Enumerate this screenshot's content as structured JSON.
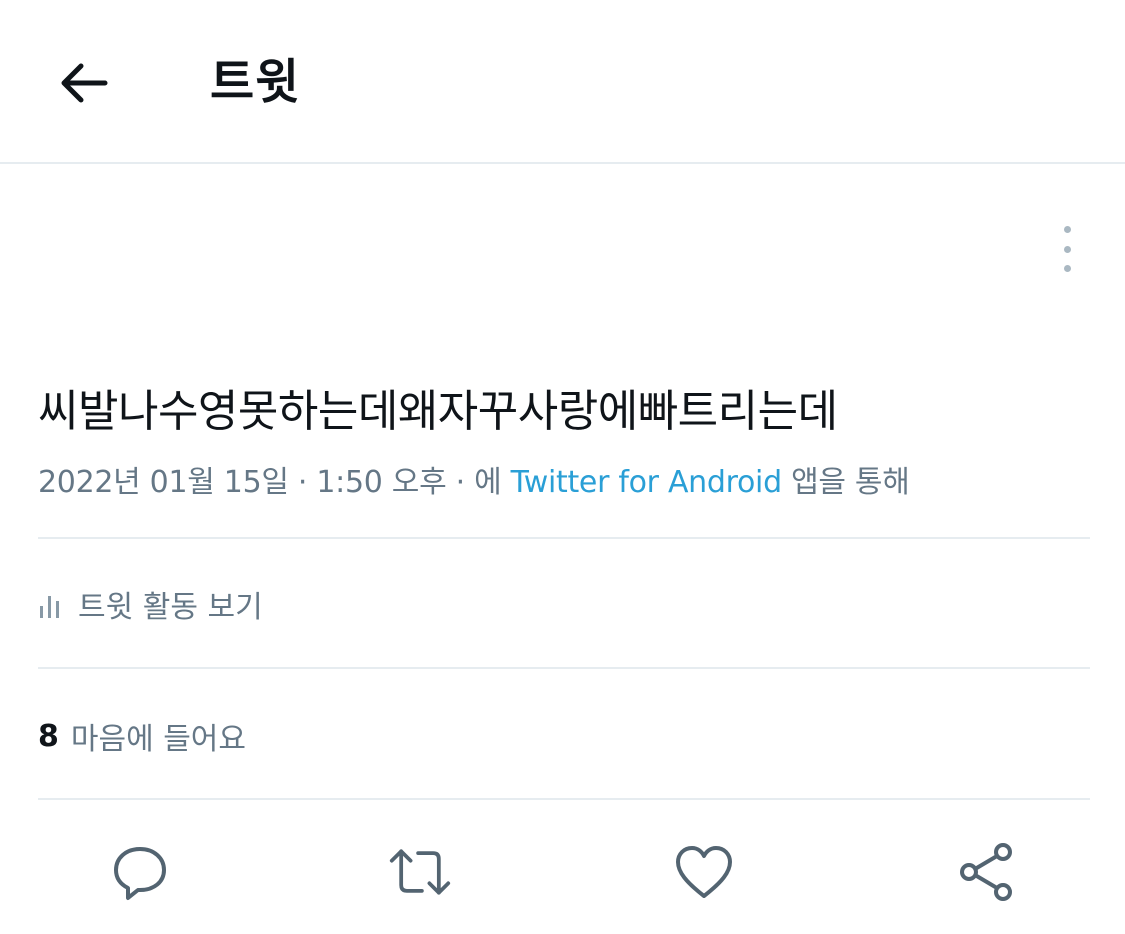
{
  "header": {
    "title": "트윗"
  },
  "tweet": {
    "text": "씨발나수영못하는데왜자꾸사랑에빠트리는데",
    "date": "2022년 01월 15일",
    "sep1": " · ",
    "time": "1:50 오후",
    "sep2": " · ",
    "via_prefix": "에 ",
    "source": "Twitter for Android",
    "via_suffix": " 앱을 통해"
  },
  "activity": {
    "label": "트윗 활동 보기"
  },
  "likes": {
    "count": "8",
    "label": "마음에 들어요"
  },
  "icons": {
    "back": "arrow-left-icon",
    "more": "more-vertical-icon",
    "analytics": "bar-chart-icon",
    "reply": "reply-icon",
    "retweet": "retweet-icon",
    "like": "heart-icon",
    "share": "share-icon"
  },
  "colors": {
    "text": "#0f1419",
    "secondary": "#657786",
    "link": "#2a9fd6",
    "divider": "#e6ecf0"
  }
}
